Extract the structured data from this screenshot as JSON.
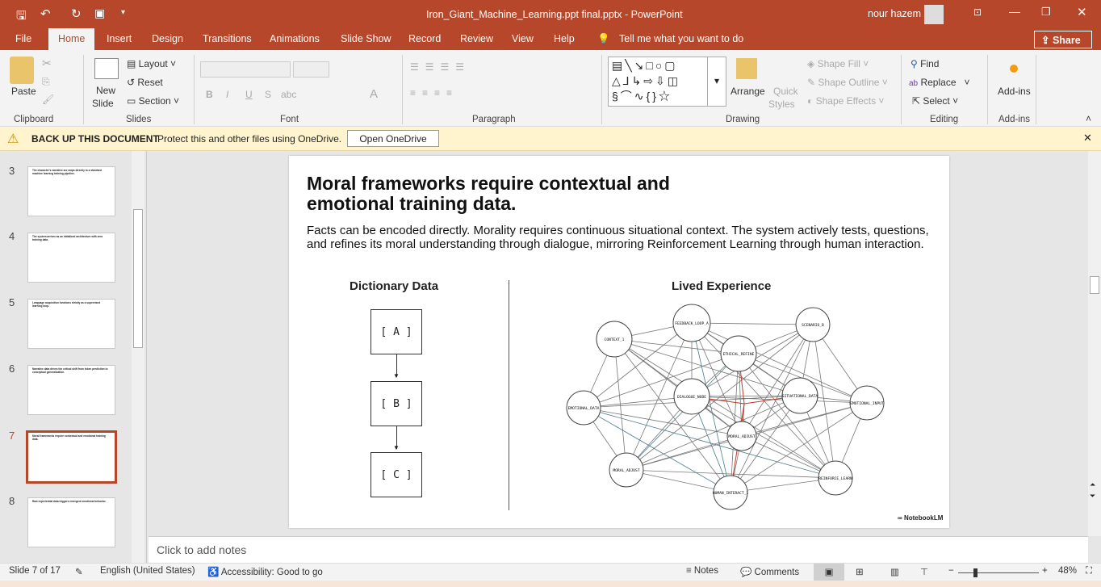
{
  "titlebar": {
    "filename": "Iron_Giant_Machine_Learning.ppt final.pptx",
    "sep": " - ",
    "app": "PowerPoint",
    "user": "nour hazem"
  },
  "tabs": [
    "File",
    "Home",
    "Insert",
    "Design",
    "Transitions",
    "Animations",
    "Slide Show",
    "Record",
    "Review",
    "View",
    "Help"
  ],
  "tell_me": "Tell me what you want to do",
  "share": "Share",
  "ribbon": {
    "clipboard": {
      "paste": "Paste",
      "label": "Clipboard"
    },
    "slides": {
      "new_slide_1": "New",
      "new_slide_2": "Slide",
      "layout": "Layout",
      "reset": "Reset",
      "section": "Section",
      "label": "Slides"
    },
    "font": {
      "label": "Font"
    },
    "paragraph": {
      "label": "Paragraph"
    },
    "drawing": {
      "arrange": "Arrange",
      "quick_styles_1": "Quick",
      "quick_styles_2": "Styles",
      "shape_fill": "Shape Fill",
      "shape_outline": "Shape Outline",
      "shape_effects": "Shape Effects",
      "label": "Drawing"
    },
    "editing": {
      "find": "Find",
      "replace": "Replace",
      "select": "Select",
      "label": "Editing"
    },
    "addins": {
      "button": "Add-ins",
      "label": "Add-ins"
    }
  },
  "message_bar": {
    "title": "BACK UP THIS DOCUMENT",
    "text": "Protect this and other files using OneDrive.",
    "button": "Open OneDrive"
  },
  "thumbnails": [
    {
      "num": "3",
      "title": "The character's narrative arc maps directly to a standard machine learning training pipeline."
    },
    {
      "num": "4",
      "title": "The system arrives as an initialized architecture with zero training data."
    },
    {
      "num": "5",
      "title": "Language acquisition functions strictly as a supervised learning loop."
    },
    {
      "num": "6",
      "title": "Narrative data drives the critical shift from token prediction to conceptual generalization."
    },
    {
      "num": "7",
      "title": "Moral frameworks require contextual and emotional training data."
    },
    {
      "num": "8",
      "title": "Raw experiential data triggers emergent emotional behavior."
    }
  ],
  "slide": {
    "title": "Moral frameworks require contextual and emotional training data.",
    "body": "Facts can be encoded directly. Morality requires continuous situational context. The system actively tests, questions, and refines its moral understanding through dialogue, mirroring Reinforcement Learning through human interaction.",
    "left_heading": "Dictionary Data",
    "boxes": [
      "[ A ]",
      "[ B ]",
      "[ C ]"
    ],
    "right_heading": "Lived Experience",
    "nodes": [
      "CONTEXT_1",
      "FEEDBACK_LOOP_A",
      "SCENARIO_B",
      "ETHICAL_REFINE",
      "EMOTIONAL_DATA",
      "DIALOGUE_NODE",
      "SITUATIONAL_DATA",
      "EMOTIONAL_INPUT",
      "MORAL_ADJUST",
      "MORAL_ADJUST",
      "HUMAN_INTERACT_1",
      "REINFORCE_LEARN"
    ],
    "logo": "NotebookLM"
  },
  "notes_placeholder": "Click to add notes",
  "status": {
    "slide": "Slide 7 of 17",
    "language": "English (United States)",
    "accessibility": "Accessibility: Good to go",
    "notes": "Notes",
    "comments": "Comments",
    "zoom": "48%",
    "zoom_fraction": 0.48
  },
  "colors": {
    "accent": "#b7472a",
    "message": "#fff4ce",
    "edge_red": "#c0392b",
    "edge_blue": "#4a7a8c"
  }
}
